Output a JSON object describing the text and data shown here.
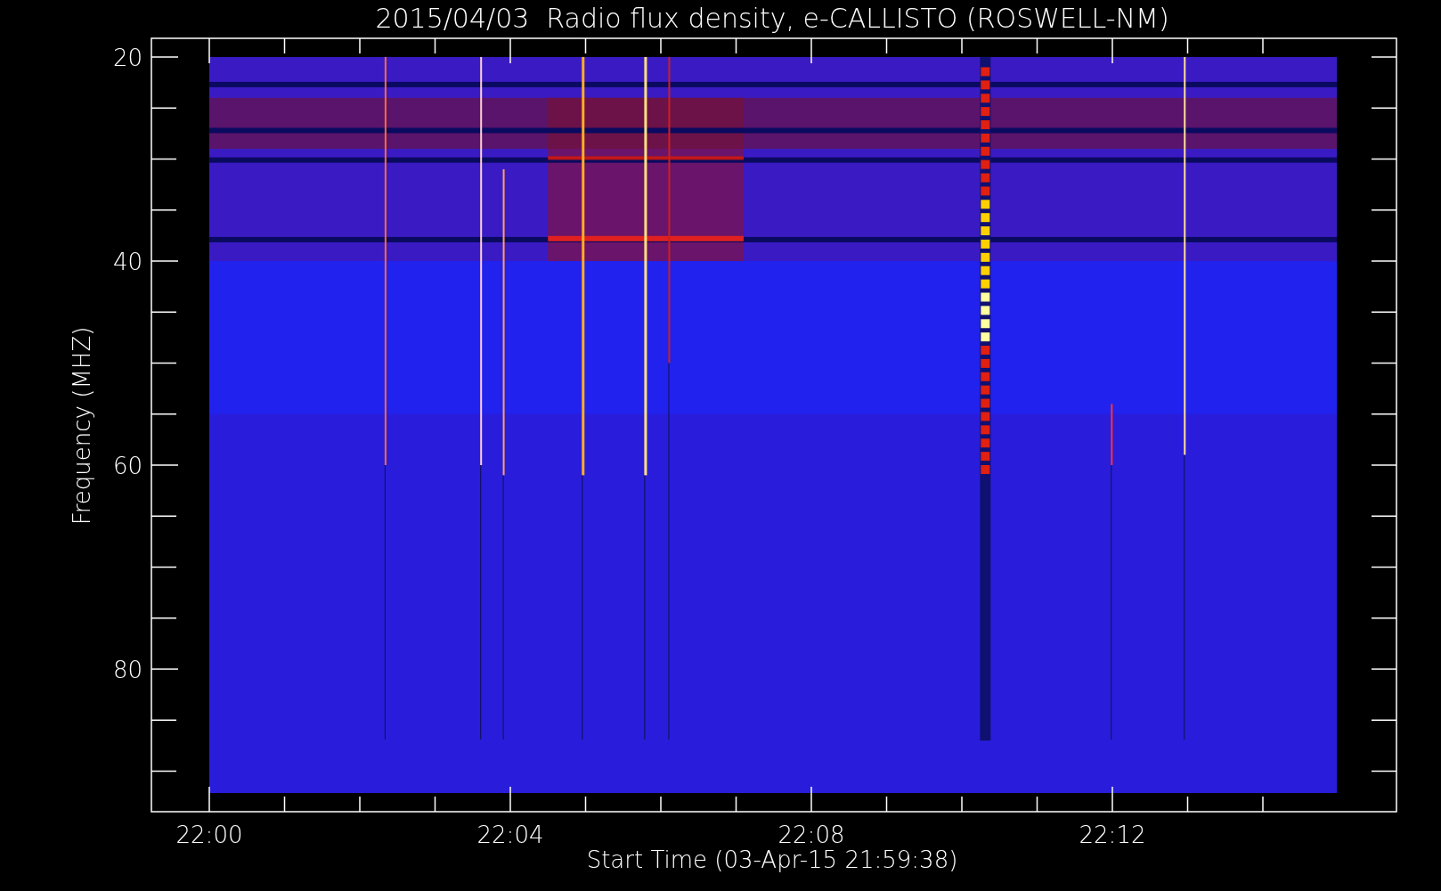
{
  "title": "2015/04/03  Radio flux density, e-CALLISTO (ROSWELL-NM)",
  "y_axis": {
    "label": "Frequency (MHZ)",
    "ticks": [
      "20",
      "40",
      "60",
      "80"
    ]
  },
  "x_axis": {
    "label": "Start Time (03-Apr-15 21:59:38)",
    "ticks": [
      "22:00",
      "22:04",
      "22:08",
      "22:12"
    ]
  }
}
